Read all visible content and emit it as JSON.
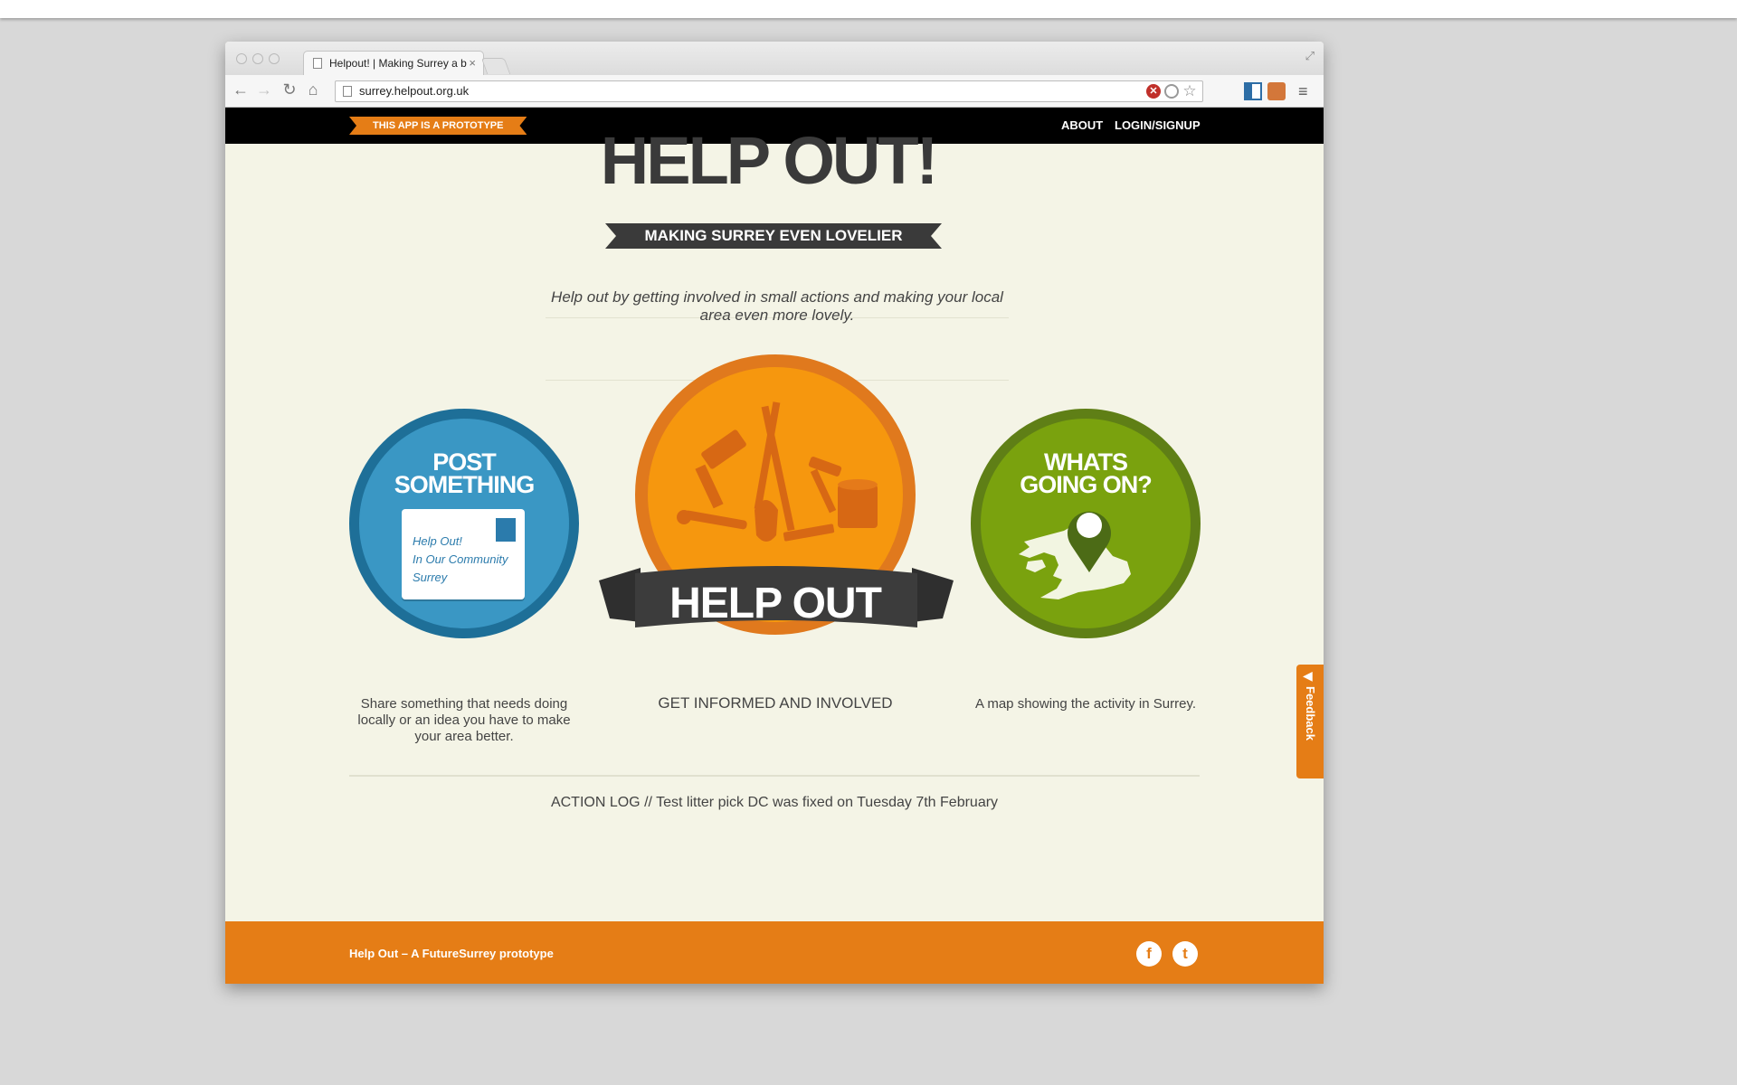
{
  "browser": {
    "tab_title": "Helpout! | Making Surrey a b",
    "tab_close": "×",
    "url": "surrey.helpout.org.uk",
    "icons": [
      "back-arrow-icon",
      "forward-arrow-icon",
      "reload-icon",
      "home-icon",
      "page-icon",
      "adblock-icon",
      "no-tracking-icon",
      "star-icon",
      "trello-extension-icon",
      "agent-extension-icon",
      "menu-icon",
      "fullscreen-icon"
    ]
  },
  "site_nav": {
    "prototype_badge": "THIS APP IS A PROTOTYPE",
    "about": "ABOUT",
    "login": "LOGIN/SIGNUP"
  },
  "hero": {
    "title": "HELP OUT!",
    "tagline": "MAKING SURREY EVEN LOVELIER",
    "intro": "Help out by getting involved in small actions and making your local area even more lovely."
  },
  "features": {
    "post": {
      "title_line1": "POST",
      "title_line2": "SOMETHING",
      "postcard_line1": "Help Out!",
      "postcard_line2": "In Our Community",
      "postcard_line3": "Surrey",
      "caption": "Share something that needs doing locally or an idea you have to make your area better.",
      "color": "#3a97c4"
    },
    "help": {
      "banner": "HELP OUT",
      "caption": "GET INFORMED AND INVOLVED",
      "color": "#f0890e"
    },
    "map": {
      "title_line1": "WHATS",
      "title_line2": "GOING ON?",
      "caption": "A map showing the activity in Surrey.",
      "color": "#7aa20e"
    }
  },
  "action_log": "ACTION LOG // Test litter pick DC was fixed on Tuesday 7th February",
  "footer": {
    "text": "Help Out – A FutureSurrey prototype",
    "facebook": "f",
    "twitter": "t"
  },
  "feedback": "Feedback",
  "colors": {
    "orange": "#e57d16",
    "page_bg": "#f4f4e6",
    "dark": "#3a3a3a"
  }
}
